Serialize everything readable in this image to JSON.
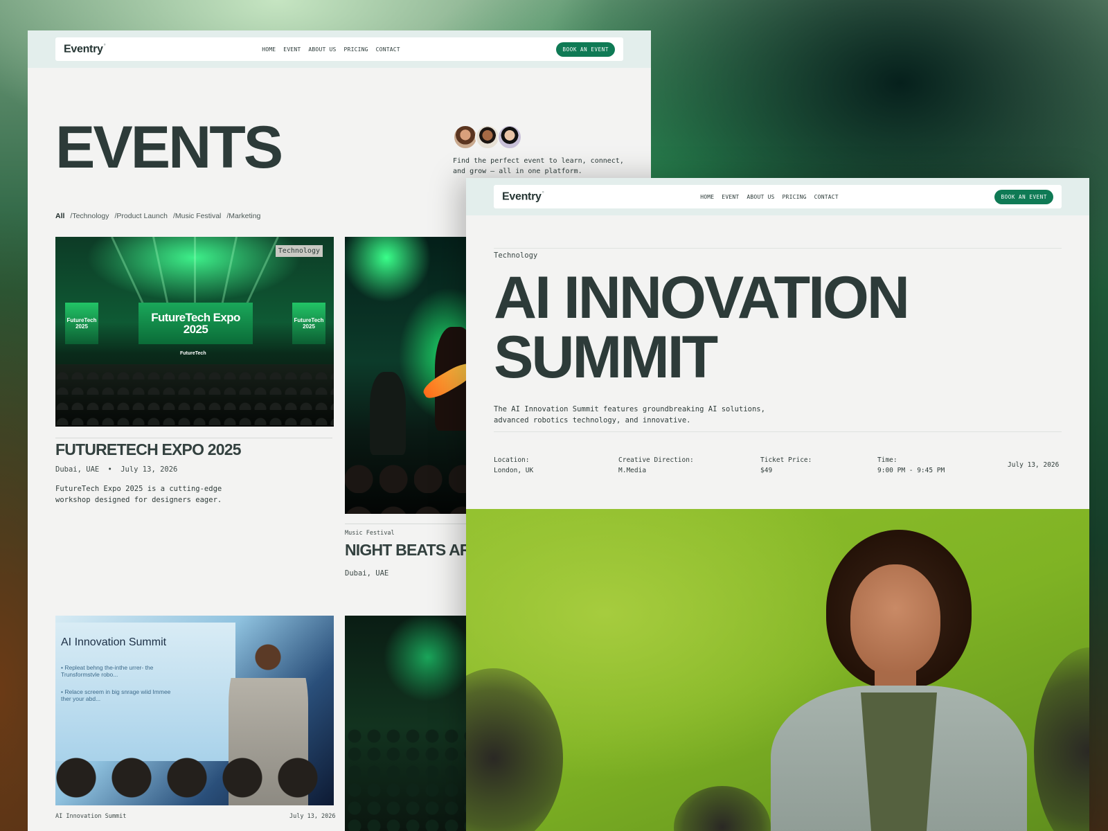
{
  "brand": {
    "name": "Eventry",
    "mark": "°"
  },
  "nav": {
    "items": [
      "HOME",
      "EVENT",
      "ABOUT US",
      "PRICING",
      "CONTACT"
    ],
    "cta": "BOOK AN EVENT"
  },
  "events_page": {
    "title": "EVENTS",
    "tagline": "Find the perfect event to learn, connect, and grow — all in one platform.",
    "filters": [
      "All",
      "/Technology",
      "/Product Launch",
      "/Music Festival",
      "/Marketing"
    ],
    "cards": [
      {
        "badge": "Technology",
        "image_text": {
          "main": "FutureTech Expo 2025",
          "side": "FutureTech 2025",
          "banner": "FutureTech"
        },
        "title": "FUTURETECH EXPO 2025",
        "location": "Dubai, UAE",
        "separator": "•",
        "date": "July 13, 2026",
        "description": "FutureTech Expo 2025 is a cutting-edge workshop designed for designers eager."
      },
      {
        "category": "Music Festival",
        "title": "NIGHT BEATS AR",
        "location": "Dubai, UAE"
      },
      {
        "image_text": {
          "slide_title": "AI Innovation Summit",
          "bullet_1": "• Repleat behng the-inthe urrer-   the Trunsformstvle robo...",
          "bullet_2": "• Relace screem in big snrage wiid Immee ther your abd..."
        },
        "category": "AI Innovation Summit",
        "date": "July 13, 2026"
      }
    ]
  },
  "detail_page": {
    "category": "Technology",
    "title_line1": "AI INNOVATION",
    "title_line2": "SUMMIT",
    "description": "The AI Innovation Summit features groundbreaking AI solutions, advanced robotics technology, and innovative.",
    "info": {
      "location_label": "Location:",
      "location": "London, UK",
      "direction_label": "Creative Direction:",
      "direction": "M.Media",
      "price_label": "Ticket Price:",
      "price": "$49",
      "time_label": "Time:",
      "time": "9:00 PM - 9:45 PM",
      "date": "July 13, 2026"
    }
  },
  "colors": {
    "accent": "#0f7a55",
    "heading": "#2d3b39",
    "panel": "#f3f3f2",
    "nav_band": "#e3eeec"
  }
}
